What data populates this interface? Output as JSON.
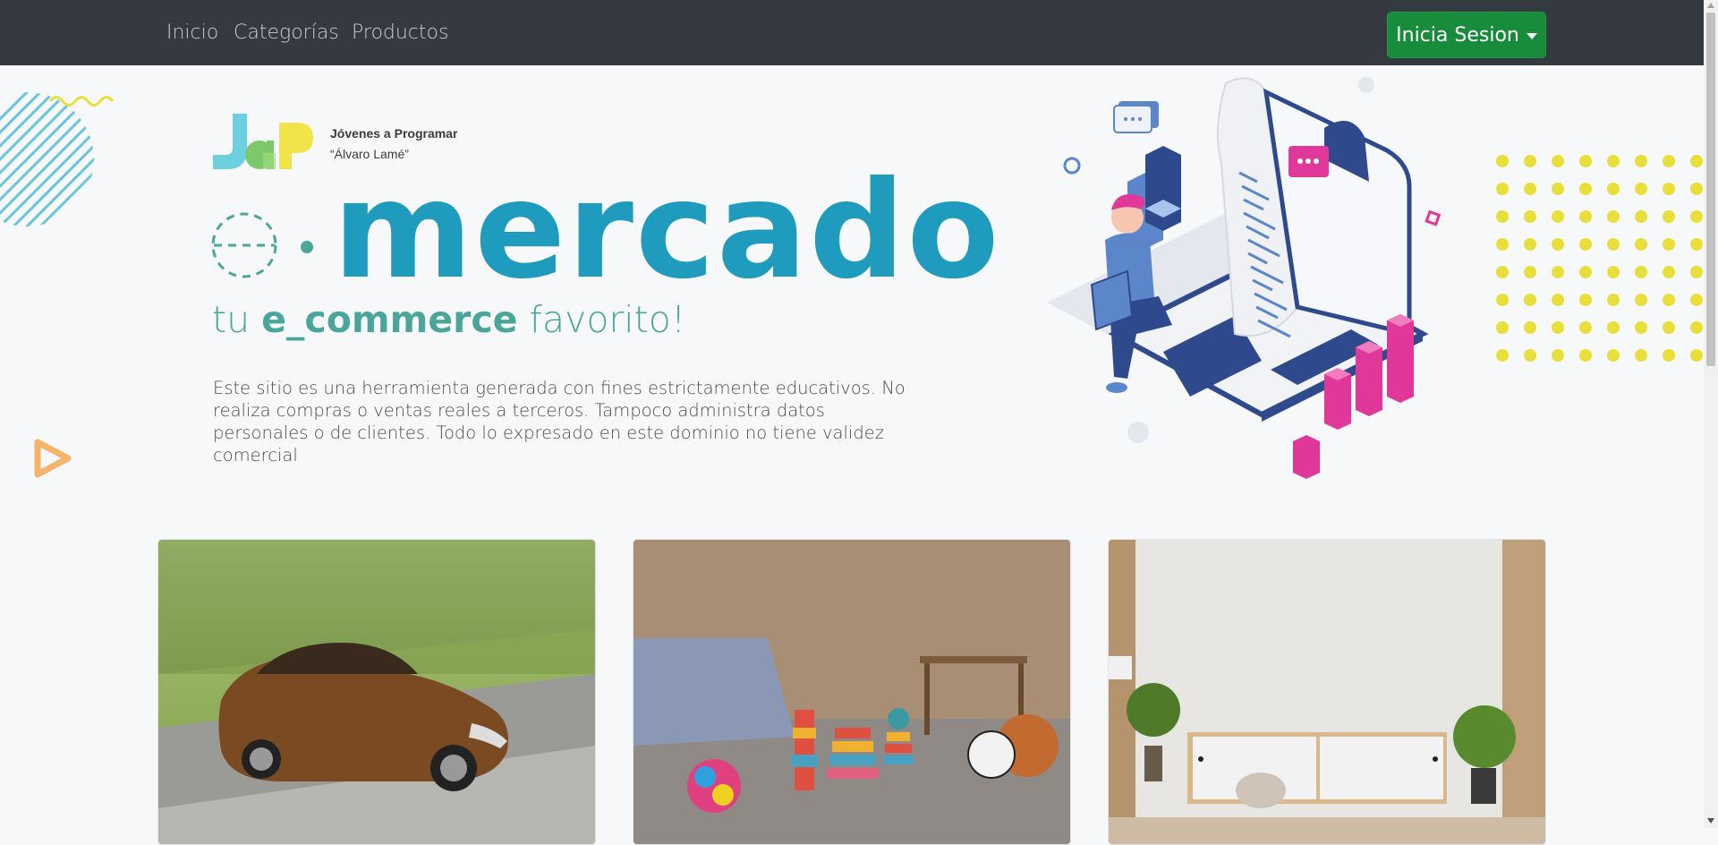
{
  "nav": {
    "links": [
      "Inicio",
      "Categorías",
      "Productos"
    ],
    "login_label": "Inicia Sesion"
  },
  "hero": {
    "org_name": "Jóvenes a Programar",
    "org_sub": "“Álvaro Lamé”",
    "brand": "mercado",
    "tagline_pre": "tu",
    "tagline_bold": "e_commerce",
    "tagline_post": "favorito!",
    "disclaimer": "Este sitio  es una herramienta generada con fines estrictamente educativos. No realiza compras o ventas reales a terceros. Tampoco administra datos personales o de clientes. Todo lo expresado en este dominio no tiene validez comercial"
  },
  "cards": [
    {
      "icon": "car-image"
    },
    {
      "icon": "toys-image"
    },
    {
      "icon": "furniture-image"
    }
  ],
  "colors": {
    "navbar": "#343a40",
    "login_button": "#198c3c",
    "brand": "#1f9bbd",
    "tagline": "#4aa59a",
    "accent_pink": "#e0389a",
    "accent_yellow": "#e8df3a"
  }
}
